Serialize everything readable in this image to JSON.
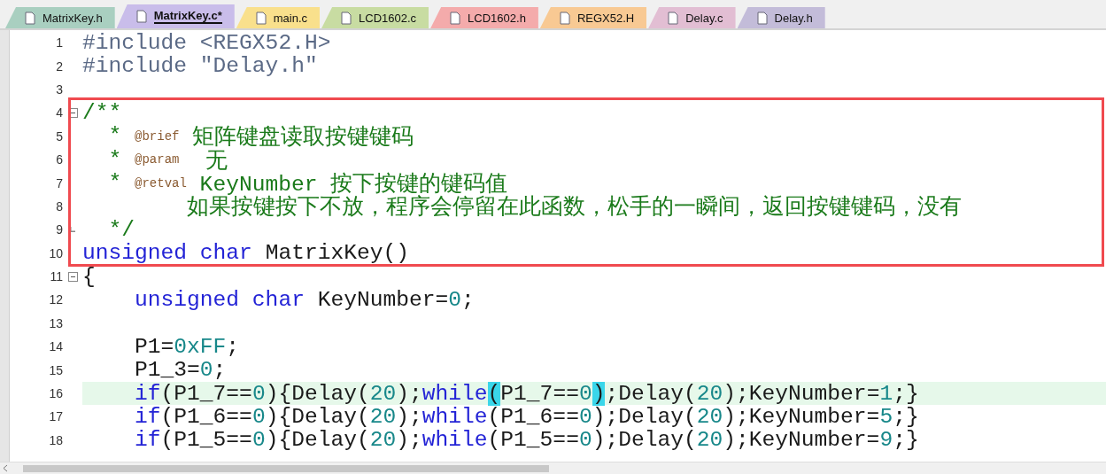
{
  "tabs": [
    {
      "label": "MatrixKey.h",
      "selected": false,
      "color": "#a9cfc0"
    },
    {
      "label": "MatrixKey.c*",
      "selected": true,
      "color": "#c9bdea"
    },
    {
      "label": "main.c",
      "selected": false,
      "color": "#f9e08c"
    },
    {
      "label": "LCD1602.c",
      "selected": false,
      "color": "#c8dca2"
    },
    {
      "label": "LCD1602.h",
      "selected": false,
      "color": "#f4abab"
    },
    {
      "label": "REGX52.H",
      "selected": false,
      "color": "#f8c993"
    },
    {
      "label": "Delay.c",
      "selected": false,
      "color": "#e2bed3"
    },
    {
      "label": "Delay.h",
      "selected": false,
      "color": "#c3bcd9"
    }
  ],
  "annotation": {
    "kind": "rectangle",
    "color": "#f04a4f"
  },
  "lines": [
    {
      "number": "1",
      "tokens": [
        {
          "kind": "preprocessor",
          "text": "#include <REGX52.H>"
        }
      ]
    },
    {
      "number": "2",
      "tokens": [
        {
          "kind": "preprocessor",
          "text": "#include \"Delay.h\""
        }
      ]
    },
    {
      "number": "3"
    },
    {
      "number": "4",
      "fold_start": true,
      "boxed": true,
      "tokens": [
        {
          "kind": "comment",
          "text": "/**"
        }
      ]
    },
    {
      "number": "5",
      "boxed": true,
      "tokens": [
        {
          "kind": "comment",
          "text": "  * "
        },
        {
          "kind": "doctag",
          "text": "@brief"
        },
        {
          "kind": "comment",
          "text": " 矩阵键盘读取按键键码"
        }
      ]
    },
    {
      "number": "6",
      "boxed": true,
      "tokens": [
        {
          "kind": "comment",
          "text": "  * "
        },
        {
          "kind": "doctag",
          "text": "@param"
        },
        {
          "kind": "comment",
          "text": "  无"
        }
      ]
    },
    {
      "number": "7",
      "boxed": true,
      "tokens": [
        {
          "kind": "comment",
          "text": "  * "
        },
        {
          "kind": "doctag",
          "text": "@retval"
        },
        {
          "kind": "comment",
          "text": " KeyNumber 按下按键的键码值"
        }
      ]
    },
    {
      "number": "8",
      "boxed": true,
      "tokens": [
        {
          "kind": "comment",
          "text": "        如果按键按下不放，程序会停留在此函数，松手的一瞬间，返回按键键码，没有"
        }
      ]
    },
    {
      "number": "9",
      "fold_end": true,
      "boxed": true,
      "tokens": [
        {
          "kind": "comment",
          "text": "  */"
        }
      ]
    },
    {
      "number": "10",
      "boxed": true,
      "tokens": [
        {
          "kind": "keyword",
          "text": "unsigned char"
        },
        {
          "kind": "plain",
          "text": " MatrixKey()"
        }
      ]
    },
    {
      "number": "11",
      "fold_start": true,
      "tokens": [
        {
          "kind": "plain",
          "text": "{"
        }
      ]
    },
    {
      "number": "12",
      "tokens": [
        {
          "kind": "keyword",
          "text": "    unsigned char"
        },
        {
          "kind": "plain",
          "text": " KeyNumber="
        },
        {
          "kind": "number",
          "text": "0"
        },
        {
          "kind": "plain",
          "text": ";"
        }
      ]
    },
    {
      "number": "13"
    },
    {
      "number": "14",
      "tokens": [
        {
          "kind": "plain",
          "text": "    P1="
        },
        {
          "kind": "number",
          "text": "0xFF"
        },
        {
          "kind": "plain",
          "text": ";"
        }
      ]
    },
    {
      "number": "15",
      "tokens": [
        {
          "kind": "plain",
          "text": "    P1_3="
        },
        {
          "kind": "number",
          "text": "0"
        },
        {
          "kind": "plain",
          "text": ";"
        }
      ]
    },
    {
      "number": "16",
      "current": true,
      "tokens": [
        {
          "kind": "keyword",
          "text": "    if"
        },
        {
          "kind": "plain",
          "text": "(P1_7=="
        },
        {
          "kind": "number",
          "text": "0"
        },
        {
          "kind": "plain",
          "text": "){Delay("
        },
        {
          "kind": "number",
          "text": "20"
        },
        {
          "kind": "plain",
          "text": ");"
        },
        {
          "kind": "keyword",
          "text": "while"
        },
        {
          "kind": "match",
          "text": "("
        },
        {
          "kind": "plain",
          "text": "P1_7=="
        },
        {
          "kind": "number",
          "text": "0"
        },
        {
          "kind": "match",
          "text": ")"
        },
        {
          "kind": "plain",
          "text": ";Delay("
        },
        {
          "kind": "number",
          "text": "20"
        },
        {
          "kind": "plain",
          "text": ");KeyNumber="
        },
        {
          "kind": "number",
          "text": "1"
        },
        {
          "kind": "plain",
          "text": ";}"
        }
      ]
    },
    {
      "number": "17",
      "tokens": [
        {
          "kind": "keyword",
          "text": "    if"
        },
        {
          "kind": "plain",
          "text": "(P1_6=="
        },
        {
          "kind": "number",
          "text": "0"
        },
        {
          "kind": "plain",
          "text": "){Delay("
        },
        {
          "kind": "number",
          "text": "20"
        },
        {
          "kind": "plain",
          "text": ");"
        },
        {
          "kind": "keyword",
          "text": "while"
        },
        {
          "kind": "plain",
          "text": "(P1_6=="
        },
        {
          "kind": "number",
          "text": "0"
        },
        {
          "kind": "plain",
          "text": ");Delay("
        },
        {
          "kind": "number",
          "text": "20"
        },
        {
          "kind": "plain",
          "text": ");KeyNumber="
        },
        {
          "kind": "number",
          "text": "5"
        },
        {
          "kind": "plain",
          "text": ";}"
        }
      ]
    },
    {
      "number": "18",
      "tokens": [
        {
          "kind": "keyword",
          "text": "    if"
        },
        {
          "kind": "plain",
          "text": "(P1_5=="
        },
        {
          "kind": "number",
          "text": "0"
        },
        {
          "kind": "plain",
          "text": "){Delay("
        },
        {
          "kind": "number",
          "text": "20"
        },
        {
          "kind": "plain",
          "text": ");"
        },
        {
          "kind": "keyword",
          "text": "while"
        },
        {
          "kind": "plain",
          "text": "(P1_5=="
        },
        {
          "kind": "number",
          "text": "0"
        },
        {
          "kind": "plain",
          "text": ");Delay("
        },
        {
          "kind": "number",
          "text": "20"
        },
        {
          "kind": "plain",
          "text": ");KeyNumber="
        },
        {
          "kind": "number",
          "text": "9"
        },
        {
          "kind": "plain",
          "text": ";}"
        }
      ]
    }
  ]
}
